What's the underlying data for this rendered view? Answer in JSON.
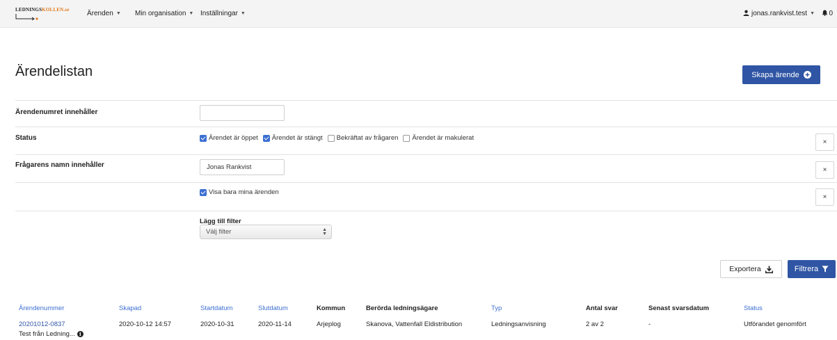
{
  "app": {
    "logo_text_dark": "LEDNINGS",
    "logo_text_accent": "KOLLEN.se",
    "accent_color": "#e07a1f",
    "primary_color": "#2f55a4"
  },
  "nav": {
    "items": [
      {
        "label": "Ärenden"
      },
      {
        "label": "Min organisation"
      },
      {
        "label": "Inställningar"
      }
    ],
    "user": "jonas.rankvist.test",
    "notifications": "0"
  },
  "page": {
    "title": "Ärendelistan",
    "create_button": "Skapa ärende"
  },
  "filters": {
    "case_number_label": "Ärendenumret innehåller",
    "case_number_value": "",
    "status_label": "Status",
    "status_options": [
      {
        "label": "Ärendet är öppet",
        "checked": true
      },
      {
        "label": "Ärendet är stängt",
        "checked": true
      },
      {
        "label": "Bekräftat av frågaren",
        "checked": false
      },
      {
        "label": "Ärendet är makulerat",
        "checked": false
      }
    ],
    "requester_label": "Frågarens namn innehåller",
    "requester_value": "Jonas Rankvist",
    "mine_only_label": "Visa bara mina ärenden",
    "mine_only_checked": true,
    "clear_symbol": "×",
    "add_filter_label": "Lägg till filter",
    "add_filter_selected": "Välj filter"
  },
  "actions": {
    "export": "Exportera",
    "filter": "Filtrera"
  },
  "table": {
    "columns": [
      {
        "label": "Ärendenummer",
        "sortable": true
      },
      {
        "label": "Skapad",
        "sortable": true
      },
      {
        "label": "Startdatum",
        "sortable": true
      },
      {
        "label": "Slutdatum",
        "sortable": true
      },
      {
        "label": "Kommun",
        "sortable": false
      },
      {
        "label": "Berörda ledningsägare",
        "sortable": false
      },
      {
        "label": "Typ",
        "sortable": true
      },
      {
        "label": "Antal svar",
        "sortable": false
      },
      {
        "label": "Senast svarsdatum",
        "sortable": false
      },
      {
        "label": "Status",
        "sortable": true
      }
    ],
    "rows": [
      {
        "case_number": "20201012-0837",
        "title": "Test från Ledning...",
        "created": "2020-10-12 14:57",
        "start": "2020-10-31",
        "end": "2020-11-14",
        "municipality": "Arjeplog",
        "owners": "Skanova, Vattenfall Eldistribution",
        "type": "Ledningsanvisning",
        "answers": "2 av 2",
        "last_answer": "-",
        "status": "Utförandet genomfört"
      }
    ]
  }
}
